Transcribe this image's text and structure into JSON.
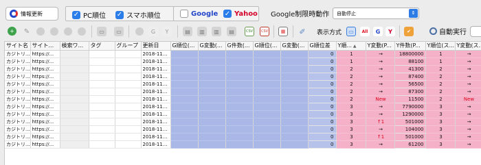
{
  "topbar": {
    "update_label": "情報更新",
    "pc_rank_label": "PC順位",
    "pc_rank_checked": true,
    "sp_rank_label": "スマホ順位",
    "sp_rank_checked": true,
    "google_label": "Google",
    "google_checked": false,
    "yahoo_label": "Yahoo",
    "yahoo_checked": true,
    "limit_label": "Google制限時動作",
    "limit_value": "自動停止"
  },
  "toolbar": {
    "display_label": "表示方式",
    "auto_run_label": "自動実行",
    "icons": [
      "add-icon",
      "edit-icon",
      "disabled-icon",
      "disabled-icon",
      "disabled-icon",
      "disabled-icon",
      "disabled-icon",
      "disabled-icon",
      "disabled-icon",
      "disabled-icon",
      "disabled-icon",
      "disabled-icon",
      "disabled-icon",
      "disabled-icon",
      "csv-import-icon",
      "csv-export-icon",
      "report-icon",
      "settings-icon",
      "view-list-icon",
      "view-all-icon",
      "view-google-icon",
      "view-yahoo-icon",
      "check-icon"
    ]
  },
  "table": {
    "columns": [
      "サイト名",
      "サイト...",
      "検索ワ...",
      "タグ",
      "グループ",
      "更新日",
      "G順位(...",
      "G変動(...",
      "G件数(...",
      "G順位(...",
      "G変動(...",
      "G順位差",
      "Y順...",
      "Y変動(P...",
      "Y件数(P...",
      "Y順位(ス...",
      "Y変動(ス..."
    ],
    "sorted_column_index": 12,
    "rows": [
      {
        "site": "カジトリ...",
        "url": "https://...",
        "date": "2018-11...",
        "gdiff": "0",
        "yrank": "1",
        "ychange": "→",
        "ycount": "18800000",
        "yrank_sp": "1",
        "ychange_sp": "→"
      },
      {
        "site": "カジトリ...",
        "url": "https://...",
        "date": "2018-11...",
        "gdiff": "0",
        "yrank": "1",
        "ychange": "→",
        "ycount": "88100",
        "yrank_sp": "1",
        "ychange_sp": "→"
      },
      {
        "site": "カジトリ...",
        "url": "https://...",
        "date": "2018-11...",
        "gdiff": "0",
        "yrank": "2",
        "ychange": "→",
        "ycount": "41300",
        "yrank_sp": "2",
        "ychange_sp": "→"
      },
      {
        "site": "カジトリ...",
        "url": "https://...",
        "date": "2018-11...",
        "gdiff": "0",
        "yrank": "2",
        "ychange": "→",
        "ycount": "87400",
        "yrank_sp": "2",
        "ychange_sp": "→"
      },
      {
        "site": "カジトリ...",
        "url": "https://...",
        "date": "2018-11...",
        "gdiff": "0",
        "yrank": "2",
        "ychange": "→",
        "ycount": "56500",
        "yrank_sp": "2",
        "ychange_sp": "→"
      },
      {
        "site": "カジトリ...",
        "url": "https://...",
        "date": "2018-11...",
        "gdiff": "0",
        "yrank": "2",
        "ychange": "→",
        "ycount": "87300",
        "yrank_sp": "2",
        "ychange_sp": "→"
      },
      {
        "site": "カジトリ...",
        "url": "https://...",
        "date": "2018-11...",
        "gdiff": "0",
        "yrank": "2",
        "ychange": "New",
        "ycount": "11500",
        "yrank_sp": "2",
        "ychange_sp": "New"
      },
      {
        "site": "カジトリ...",
        "url": "https://...",
        "date": "2018-11...",
        "gdiff": "0",
        "yrank": "3",
        "ychange": "→",
        "ycount": "7790000",
        "yrank_sp": "3",
        "ychange_sp": "→"
      },
      {
        "site": "カジトリ...",
        "url": "https://...",
        "date": "2018-11...",
        "gdiff": "0",
        "yrank": "3",
        "ychange": "→",
        "ycount": "1290000",
        "yrank_sp": "3",
        "ychange_sp": "→"
      },
      {
        "site": "カジトリ...",
        "url": "https://...",
        "date": "2018-11...",
        "gdiff": "0",
        "yrank": "3",
        "ychange": "↑1",
        "ycount": "501000",
        "yrank_sp": "3",
        "ychange_sp": "→"
      },
      {
        "site": "カジトリ...",
        "url": "https://...",
        "date": "2018-11...",
        "gdiff": "0",
        "yrank": "3",
        "ychange": "→",
        "ycount": "104000",
        "yrank_sp": "3",
        "ychange_sp": "→"
      },
      {
        "site": "カジトリ...",
        "url": "https://...",
        "date": "2018-11...",
        "gdiff": "0",
        "yrank": "3",
        "ychange": "↑1",
        "ycount": "501000",
        "yrank_sp": "3",
        "ychange_sp": "→"
      },
      {
        "site": "カジトリ...",
        "url": "https://...",
        "date": "2018-11...",
        "gdiff": "0",
        "yrank": "3",
        "ychange": "→",
        "ycount": "61200",
        "yrank_sp": "3",
        "ychange_sp": "→"
      }
    ]
  },
  "colors": {
    "google_column_bg": "#a9b8e6",
    "yahoo_column_bg": "#f5b1c8",
    "accent": "#2b7de9",
    "new_text": "#e0001a"
  }
}
